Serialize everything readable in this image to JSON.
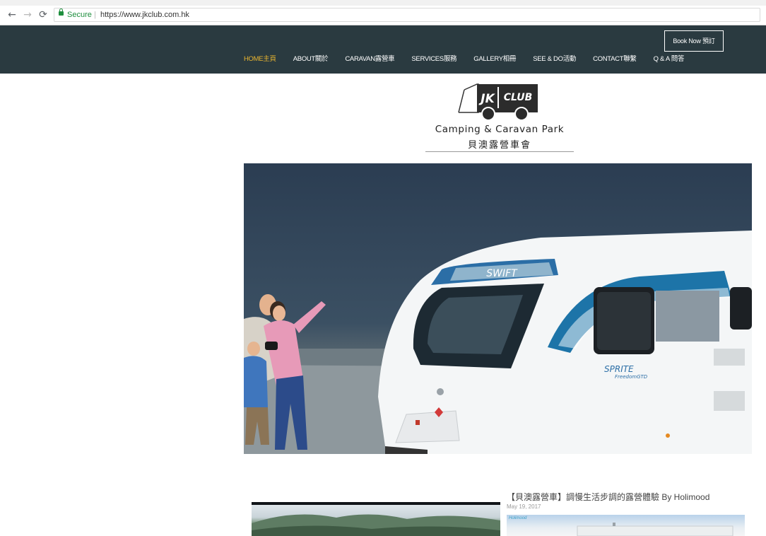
{
  "browser": {
    "secure_label": "Secure",
    "url": "https://www.jkclub.com.hk"
  },
  "header": {
    "book_label": "Book Now 預訂",
    "menu": [
      {
        "label": "HOME主頁",
        "active": true
      },
      {
        "label": "ABOUT關於",
        "active": false
      },
      {
        "label": "CARAVAN露營車",
        "active": false
      },
      {
        "label": "SERVICES服務",
        "active": false
      },
      {
        "label": "GALLERY相冊",
        "active": false
      },
      {
        "label": "SEE & DO活動",
        "active": false
      },
      {
        "label": "CONTACT聯繫",
        "active": false
      },
      {
        "label": "Q & A 問答",
        "active": false
      }
    ]
  },
  "logo": {
    "badge_left": "JK",
    "badge_right": "CLUB",
    "name_en": "Camping & Caravan Park",
    "name_zh": "貝澳露營車會"
  },
  "hero": {
    "caravan_brand": "SWIFT",
    "caravan_model": "SPRITE",
    "caravan_model_sub": "FreedomGTD"
  },
  "blog": {
    "post_title": "【貝澳露營車】調慢生活步調的露營體驗 By Holimood",
    "post_date": "May 19, 2017",
    "thumb_badge": "Holimood"
  },
  "colors": {
    "header_bg": "#2a3a40",
    "menu_active": "#e9b52f",
    "menu_text": "#ffffff"
  }
}
